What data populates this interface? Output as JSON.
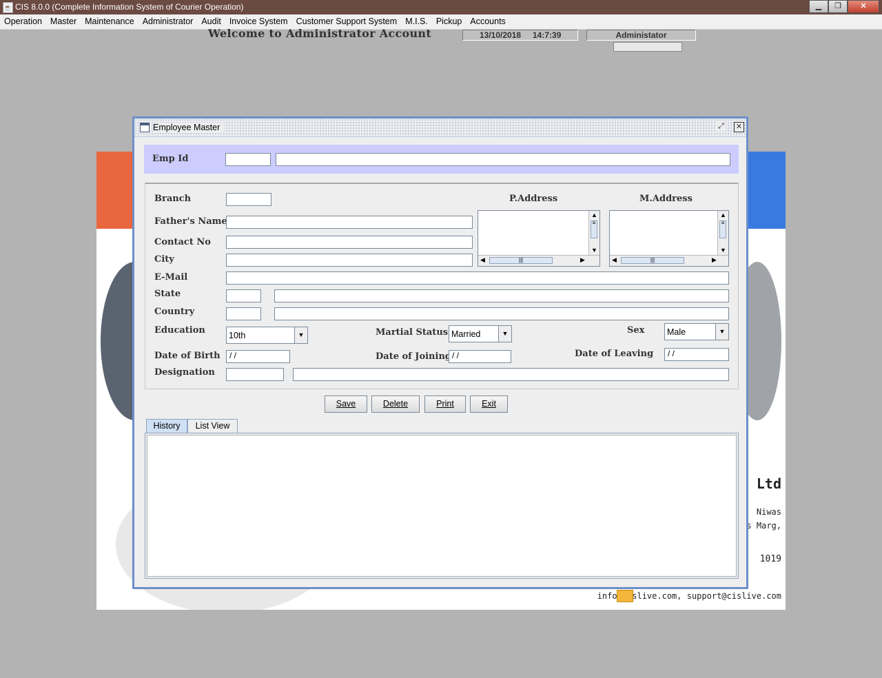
{
  "app": {
    "title": "CIS 8.0.0 (Complete Information System of Courier Operation)",
    "window_buttons": {
      "minimize": "▁",
      "maximize": "❐",
      "close": "✕"
    }
  },
  "menu": [
    "Operation",
    "Master",
    "Maintenance",
    "Administrator",
    "Audit",
    "Invoice System",
    "Customer Support System",
    "M.I.S.",
    "Pickup",
    "Accounts"
  ],
  "header": {
    "welcome": "Welcome to Administrator Account",
    "date": "13/10/2018",
    "time": "14:7:39",
    "user": "Administator"
  },
  "background": {
    "company_fragment": "rt Ltd",
    "addr_line1": "Niwas",
    "addr_line2": "s Marg,",
    "addr_line3": "1019",
    "emails": "info@cislive.com, support@cislive.com"
  },
  "dialog": {
    "title": "Employee Master",
    "restore_btn": "⤢",
    "close_btn": "✕"
  },
  "form": {
    "emp_id_label": "Emp Id",
    "emp_id": "",
    "emp_name": "",
    "branch_label": "Branch",
    "branch": "",
    "father_label": "Father's Name",
    "father": "",
    "contact_label": "Contact No",
    "contact": "",
    "city_label": "City",
    "city": "",
    "email_label": "E-Mail",
    "email": "",
    "state_label": "State",
    "state_code": "",
    "state_name": "",
    "country_label": "Country",
    "country_code": "",
    "country_name": "",
    "paddress_label": "P.Address",
    "maddress_label": "M.Address",
    "education_label": "Education",
    "education": "10th",
    "marital_label": "Martial Status",
    "marital": "Married",
    "sex_label": "Sex",
    "sex": "Male",
    "dob_label": "Date of Birth",
    "dob": "/ /",
    "doj_label": "Date of Joining",
    "doj": "/ /",
    "dol_label": "Date of Leaving",
    "dol": "/ /",
    "designation_label": "Designation",
    "designation_code": "",
    "designation_name": ""
  },
  "buttons": {
    "save": "Save",
    "delete": "Delete",
    "print": "Print",
    "exit": "Exit"
  },
  "tabs": [
    {
      "label": "History",
      "active": true
    },
    {
      "label": "List View",
      "active": false
    }
  ],
  "colors": {
    "titlebar": "#6b4a42",
    "desktop": "#b3b3b3",
    "frame_border": "#6d8fc9",
    "emp_bar": "#ccccff"
  }
}
